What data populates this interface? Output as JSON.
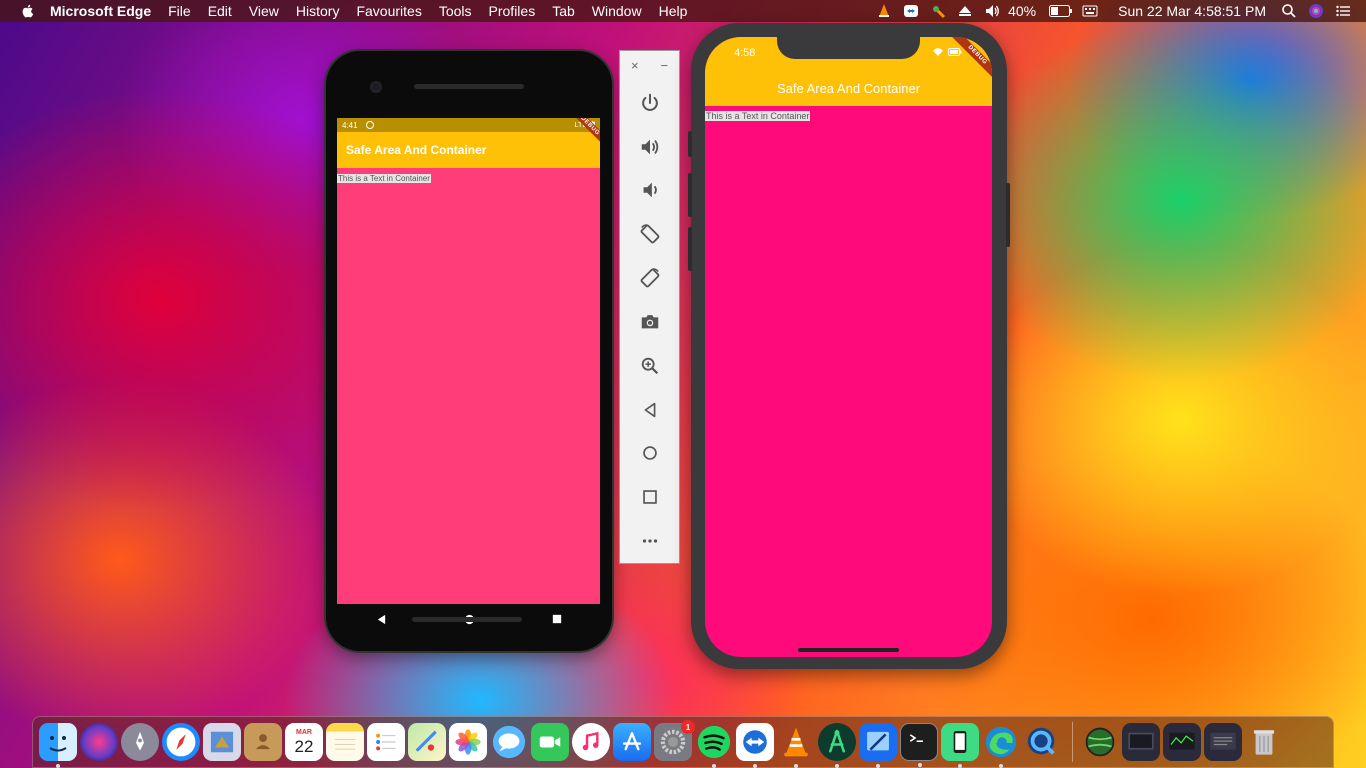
{
  "menubar": {
    "app_name": "Microsoft Edge",
    "menus": [
      "File",
      "Edit",
      "View",
      "History",
      "Favourites",
      "Tools",
      "Profiles",
      "Tab",
      "Window",
      "Help"
    ],
    "battery": "40%",
    "datetime": "Sun 22 Mar  4:58:51 PM"
  },
  "android": {
    "status_time": "4:41",
    "status_right": "LTE",
    "app_title": "Safe Area And Container",
    "body_text": "This is a Text in Container",
    "debug_label": "DEBUG",
    "colors": {
      "appbar": "#ffc107",
      "body": "#ff3d78"
    }
  },
  "emulator_toolbar": {
    "close": "×",
    "minimize": "−",
    "tools": [
      "power-icon",
      "volume-up-icon",
      "volume-down-icon",
      "rotate-left-icon",
      "rotate-right-icon",
      "camera-icon",
      "zoom-icon",
      "back-icon",
      "home-icon",
      "overview-icon",
      "more-icon"
    ]
  },
  "iphone": {
    "status_time": "4:58",
    "app_title": "Safe Area And Container",
    "body_text": "This is a Text in Container",
    "debug_label": "DEBUG",
    "colors": {
      "appbar": "#ffc107",
      "body": "#ff0a7a"
    }
  },
  "dock": {
    "calendar_month": "MAR",
    "calendar_day": "22",
    "system_prefs_badge": "1"
  }
}
